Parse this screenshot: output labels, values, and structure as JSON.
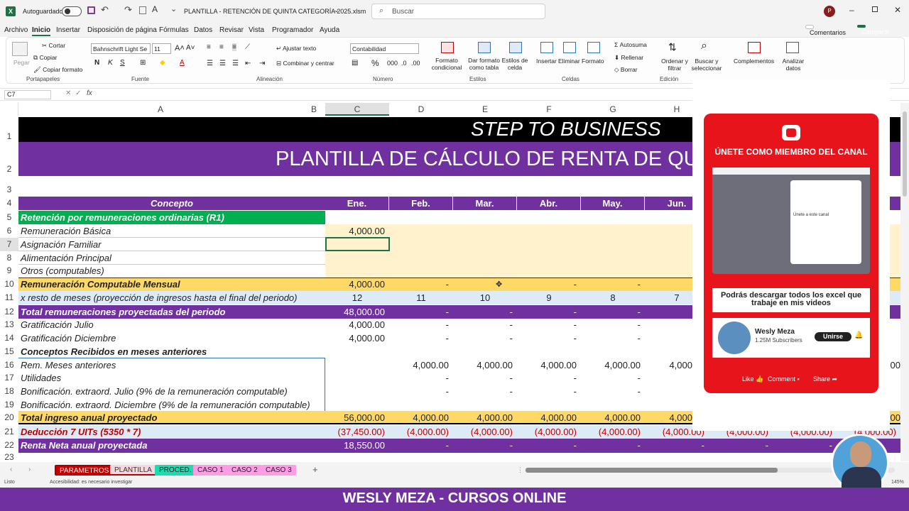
{
  "app": {
    "autosave_label": "Autoguardado",
    "filename": "PLANTILLA - RETENCIÓN DE QUINTA CATEGORÍA 2025.xlsm",
    "search_placeholder": "Buscar",
    "avatar_initial": "P"
  },
  "tabs": [
    "Archivo",
    "Inicio",
    "Insertar",
    "Disposición de página",
    "Fórmulas",
    "Datos",
    "Revisar",
    "Vista",
    "Programador",
    "Ayuda"
  ],
  "tab_buttons": {
    "comments": "Comentarios",
    "share": "Compartir"
  },
  "ribbon": {
    "paste": "Pegar",
    "cut": "Cortar",
    "copy": "Copiar",
    "format_painter": "Copiar formato",
    "clipboard": "Portapapeles",
    "font_name": "Bahnschrift Light Se",
    "font_size": "11",
    "font_group": "Fuente",
    "wrap_text": "Ajustar texto",
    "merge_center": "Combinar y centrar",
    "alignment": "Alineación",
    "number_format": "Contabilidad",
    "number": "Número",
    "cond_format": "Formato condicional",
    "format_table": "Dar formato como tabla",
    "cell_styles": "Estilos de celda",
    "styles": "Estilos",
    "insert": "Insertar",
    "delete": "Eliminar",
    "format": "Formato",
    "cells": "Celdas",
    "autosum": "Autosuma",
    "fill": "Rellenar",
    "clear": "Borrar",
    "sort_filter": "Ordenar y filtrar",
    "find_select": "Buscar y seleccionar",
    "editing": "Edición",
    "addins": "Complementos",
    "analyze": "Analizar datos"
  },
  "formula_bar": {
    "name_box": "C7",
    "fx": "fx"
  },
  "columns": [
    "A",
    "B",
    "C",
    "D",
    "E",
    "F",
    "G",
    "H"
  ],
  "rows": [
    "1",
    "2",
    "3",
    "4",
    "5",
    "6",
    "7",
    "8",
    "9",
    "10",
    "11",
    "12",
    "13",
    "14",
    "15",
    "16",
    "17",
    "18",
    "19",
    "20",
    "21",
    "22",
    "23"
  ],
  "sheet": {
    "r1": "STEP TO BUSINESS",
    "r2": "PLANTILLA DE CÁLCULO DE RENTA DE QUINTA C",
    "concept_header": "Concepto",
    "months": [
      "Ene.",
      "Feb.",
      "Mar.",
      "Abr.",
      "May.",
      "Jun."
    ],
    "r5": "Retención por remuneraciones ordinarias (R1)",
    "r6": "Remuneración Básica",
    "r6_c": "4,000.00",
    "r7": "Asignación Familiar",
    "r8": "Alimentación Principal",
    "r9": "Otros (computables)",
    "r10": "Remuneración Computable Mensual",
    "r10_vals": [
      "4,000.00",
      "-",
      "",
      "-",
      "-"
    ],
    "r11": "x resto de meses (proyección de ingresos  hasta el final del periodo)",
    "r11_vals": [
      "12",
      "11",
      "10",
      "9",
      "8",
      "7"
    ],
    "r12": "Total remuneraciones proyectadas del periodo",
    "r12_vals": [
      "48,000.00",
      "-",
      "-",
      "-",
      "-"
    ],
    "r13": "Gratificación Julio",
    "r13_vals": [
      "4,000.00",
      "-",
      "-",
      "-",
      "-"
    ],
    "r14": "Gratificación Diciembre",
    "r14_vals": [
      "4,000.00",
      "-",
      "-",
      "-",
      "-"
    ],
    "r15": "Conceptos Recibidos en meses anteriores",
    "r16": "Rem. Meses anteriores",
    "r16_vals": [
      "4,000.00",
      "4,000.00",
      "4,000.00",
      "4,000.00",
      "4,000"
    ],
    "r16_right": "00",
    "r17": "Utilidades",
    "r17_vals": [
      "-",
      "-",
      "-",
      "-"
    ],
    "r18": "Bonificación. extraord. Julio (9% de la remuneración computable)",
    "r18_vals": [
      "-",
      "-",
      "-",
      "-"
    ],
    "r19": "Bonificación. extraord. Diciembre (9% de la remuneración computable)",
    "r20": "Total ingreso anual proyectado",
    "r20_vals": [
      "56,000.00",
      "4,000.00",
      "4,000.00",
      "4,000.00",
      "4,000.00",
      "4,000"
    ],
    "r20_right": "00",
    "r21": "Deducción 7 UITs (5350 * 7)",
    "r21_vals": [
      "(37,450.00)",
      "(4,000.00)",
      "(4,000.00)",
      "(4,000.00)",
      "(4,000.00)",
      "(4,000.00)",
      "(4,000.00)",
      "(4,000.00)",
      "(4,000.00)"
    ],
    "r22": "Renta Neta anual proyectada",
    "r22_vals": [
      "18,550.00",
      "-",
      "-",
      "-",
      "-",
      "-",
      "-",
      "-"
    ]
  },
  "sheet_tabs": [
    "PARAMETROS",
    "PLANTILLA",
    "PROCED.",
    "CASO 1",
    "CASO 2",
    "CASO 3"
  ],
  "status": {
    "ready": "Listo",
    "accessibility": "Accesibilidad: es necesario investigar",
    "zoom": "145%"
  },
  "popup": {
    "title": "ÚNETE COMO MIEMBRO DEL CANAL",
    "download_msg": "Podrás descargar todos los excel que trabaje en mis videos",
    "channel_name": "Wesly Meza",
    "subscribers": "1.25M Subscribers",
    "join_button": "Unirse",
    "like": "Like",
    "comment": "Comment",
    "share": "Share",
    "preview_text": "Únete a este canal"
  },
  "footer": "WESLY MEZA - CURSOS ONLINE",
  "colors": {
    "purple": "#7030a0",
    "green": "#00b050",
    "yellow_light": "#fff2cc",
    "yellow": "#ffd966",
    "red": "#c00000",
    "teal": "#1ddbb1"
  }
}
